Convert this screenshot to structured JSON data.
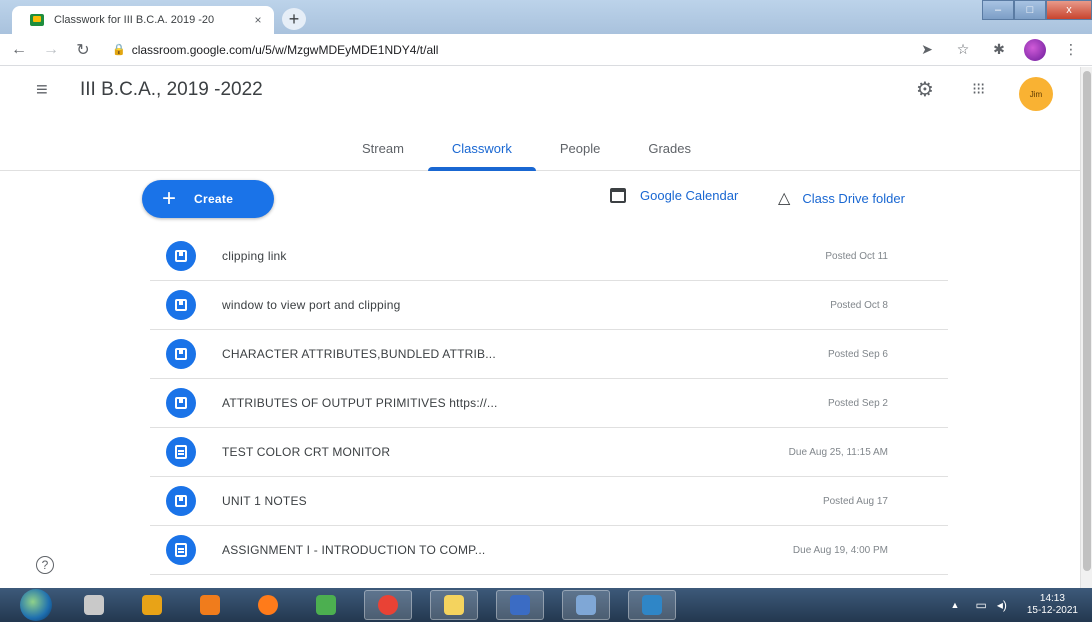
{
  "browser": {
    "tab_title": "Classwork for III B.C.A. 2019 -20",
    "tab_close": "×",
    "new_tab": "+",
    "url": "classroom.google.com/u/5/w/MzgwMDEyMDE1NDY4/t/all",
    "window_controls": {
      "minimize": "–",
      "maximize": "□",
      "close": "x"
    }
  },
  "header": {
    "class_title": "III B.C.A., 2019 -2022",
    "avatar_text": "Jim",
    "tabs": [
      {
        "label": "Stream",
        "active": false
      },
      {
        "label": "Classwork",
        "active": true
      },
      {
        "label": "People",
        "active": false
      },
      {
        "label": "Grades",
        "active": false
      }
    ]
  },
  "actions": {
    "create_label": "Create",
    "calendar_label": "Google Calendar",
    "drive_label": "Class Drive folder"
  },
  "items": [
    {
      "icon": "material-icon",
      "title": "clipping link",
      "date": "Posted Oct 11"
    },
    {
      "icon": "material-icon",
      "title": "window to view port and clipping",
      "date": "Posted Oct 8"
    },
    {
      "icon": "material-icon",
      "title": "CHARACTER ATTRIBUTES,BUNDLED ATTRIB...",
      "date": "Posted Sep 6"
    },
    {
      "icon": "material-icon",
      "title": "ATTRIBUTES OF OUTPUT PRIMITIVES https://...",
      "date": "Posted Sep 2"
    },
    {
      "icon": "assignment-icon",
      "title": "TEST COLOR CRT MONITOR",
      "date": "Due Aug 25, 11:15 AM"
    },
    {
      "icon": "material-icon",
      "title": "UNIT 1 NOTES",
      "date": "Posted Aug 17"
    },
    {
      "icon": "assignment-icon",
      "title": "ASSIGNMENT I - INTRODUCTION TO COMP...",
      "date": "Due Aug 19, 4:00 PM"
    }
  ],
  "taskbar": {
    "clock_time": "14:13",
    "clock_date": "15-12-2021",
    "apps": [
      {
        "name": "control-panel-icon",
        "color": "#c9c9c9"
      },
      {
        "name": "vlc-icon",
        "color": "#e8a317"
      },
      {
        "name": "media-player-icon",
        "color": "#f07c1c"
      },
      {
        "name": "firefox-icon",
        "color": "#ff7b1a"
      },
      {
        "name": "app-icon",
        "color": "#4caf50"
      },
      {
        "name": "chrome-icon",
        "color": "#e94235",
        "pinned": true
      },
      {
        "name": "file-explorer-icon",
        "color": "#f4d35e",
        "pinned": true
      },
      {
        "name": "word-icon",
        "color": "#3b6cc4",
        "pinned": true
      },
      {
        "name": "window-icon",
        "color": "#7fa7d6",
        "pinned": true
      },
      {
        "name": "desktop-icon",
        "color": "#2f86c7",
        "pinned": true
      }
    ]
  },
  "colors": {
    "accent": "#1a73e8",
    "tab_active": "#1967d2"
  }
}
